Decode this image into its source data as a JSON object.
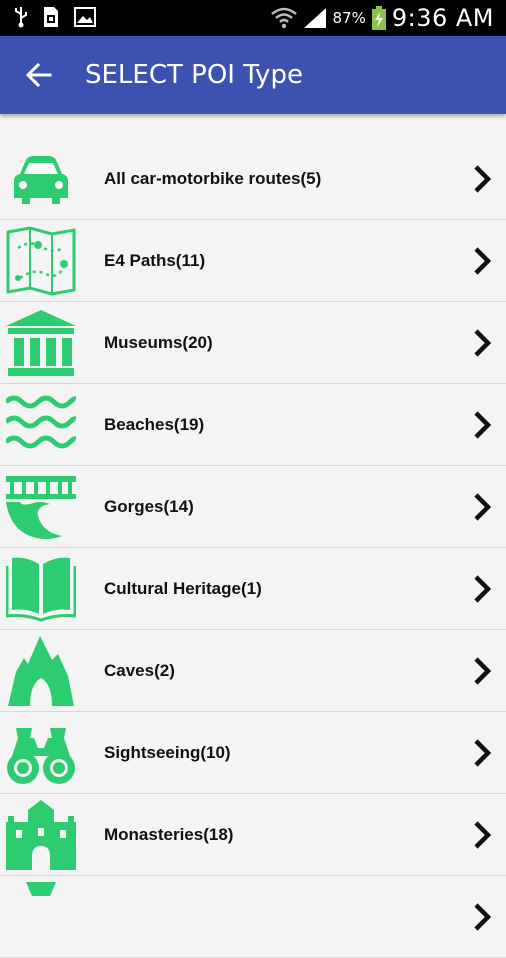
{
  "status_bar": {
    "battery_percent": "87%",
    "time": "9:36 AM",
    "icons": [
      "usb-icon",
      "sim-icon",
      "image-icon",
      "wifi-icon",
      "signal-icon",
      "battery-charging-icon"
    ]
  },
  "app_bar": {
    "title": "SELECT POI Type",
    "back_icon": "arrow-left-icon",
    "color": "#3d52b0"
  },
  "accent_color": "#2ecc71",
  "list": {
    "items": [
      {
        "label": "All car-motorbike routes(5)",
        "icon": "car-icon"
      },
      {
        "label": "E4 Paths(11)",
        "icon": "map-path-icon"
      },
      {
        "label": "Museums(20)",
        "icon": "museum-icon"
      },
      {
        "label": "Beaches(19)",
        "icon": "waves-icon"
      },
      {
        "label": "Gorges(14)",
        "icon": "gorge-bridge-icon"
      },
      {
        "label": "Cultural Heritage(1)",
        "icon": "open-book-icon"
      },
      {
        "label": "Caves(2)",
        "icon": "cave-icon"
      },
      {
        "label": "Sightseeing(10)",
        "icon": "binoculars-icon"
      },
      {
        "label": "Monasteries(18)",
        "icon": "monastery-icon"
      },
      {
        "label": "",
        "icon": "partial-icon"
      }
    ]
  }
}
